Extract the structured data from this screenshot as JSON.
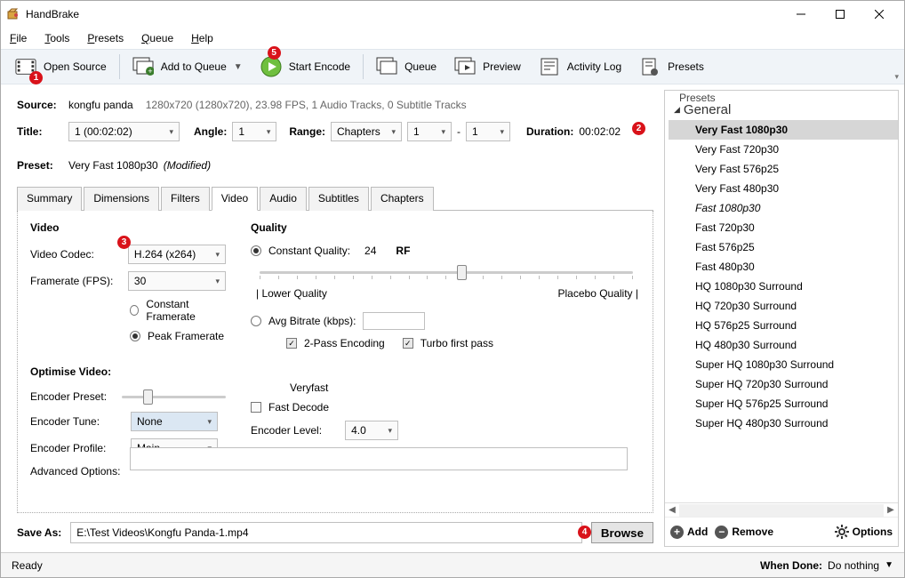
{
  "app": {
    "title": "HandBrake"
  },
  "menus": {
    "file": "File",
    "tools": "Tools",
    "presets": "Presets",
    "queue": "Queue",
    "help": "Help"
  },
  "toolbar": {
    "openSource": "Open Source",
    "addToQueue": "Add to Queue",
    "startEncode": "Start Encode",
    "queue": "Queue",
    "preview": "Preview",
    "activityLog": "Activity Log",
    "presets": "Presets"
  },
  "annotations": {
    "a1": "1",
    "a2": "2",
    "a3": "3",
    "a4": "4",
    "a5": "5"
  },
  "source": {
    "label": "Source:",
    "name": "kongfu panda",
    "meta": "1280x720 (1280x720), 23.98 FPS, 1 Audio Tracks, 0 Subtitle Tracks"
  },
  "title": {
    "label": "Title:",
    "selected": "1 (00:02:02)",
    "angleLabel": "Angle:",
    "angle": "1",
    "rangeLabel": "Range:",
    "rangeType": "Chapters",
    "rangeFrom": "1",
    "rangeDash": "-",
    "rangeTo": "1",
    "durationLabel": "Duration:",
    "duration": "00:02:02"
  },
  "preset": {
    "label": "Preset:",
    "name": "Very Fast 1080p30",
    "modified": "(Modified)"
  },
  "tabs": {
    "summary": "Summary",
    "dimensions": "Dimensions",
    "filters": "Filters",
    "video": "Video",
    "audio": "Audio",
    "subtitles": "Subtitles",
    "chapters": "Chapters"
  },
  "video": {
    "hdrVideo": "Video",
    "hdrQuality": "Quality",
    "codecLabel": "Video Codec:",
    "codec": "H.264 (x264)",
    "fpsLabel": "Framerate (FPS):",
    "fps": "30",
    "cfr": "Constant Framerate",
    "pfr": "Peak Framerate",
    "cq": "Constant Quality:",
    "cqVal": "24",
    "cqUnit": "RF",
    "sliderLow": "| Lower Quality",
    "sliderHigh": "Placebo Quality |",
    "avgBitrate": "Avg Bitrate (kbps):",
    "twoPass": "2-Pass Encoding",
    "turbo": "Turbo first pass",
    "optimiseHdr": "Optimise Video:",
    "encPresetLabel": "Encoder Preset:",
    "encPreset": "Veryfast",
    "encTuneLabel": "Encoder Tune:",
    "encTune": "None",
    "fastDecode": "Fast Decode",
    "encProfileLabel": "Encoder Profile:",
    "encProfile": "Main",
    "encLevelLabel": "Encoder Level:",
    "encLevel": "4.0",
    "advOptLabel": "Advanced Options:"
  },
  "saveAs": {
    "label": "Save As:",
    "path": "E:\\Test Videos\\Kongfu Panda-1.mp4",
    "browse": "Browse"
  },
  "presetsPanel": {
    "title": "Presets",
    "group": "General",
    "items": [
      {
        "label": "Very Fast 1080p30",
        "sel": true
      },
      {
        "label": "Very Fast 720p30"
      },
      {
        "label": "Very Fast 576p25"
      },
      {
        "label": "Very Fast 480p30"
      },
      {
        "label": "Fast 1080p30",
        "ital": true
      },
      {
        "label": "Fast 720p30"
      },
      {
        "label": "Fast 576p25"
      },
      {
        "label": "Fast 480p30"
      },
      {
        "label": "HQ 1080p30 Surround"
      },
      {
        "label": "HQ 720p30 Surround"
      },
      {
        "label": "HQ 576p25 Surround"
      },
      {
        "label": "HQ 480p30 Surround"
      },
      {
        "label": "Super HQ 1080p30 Surround"
      },
      {
        "label": "Super HQ 720p30 Surround"
      },
      {
        "label": "Super HQ 576p25 Surround"
      },
      {
        "label": "Super HQ 480p30 Surround"
      }
    ],
    "add": "Add",
    "remove": "Remove",
    "options": "Options"
  },
  "status": {
    "left": "Ready",
    "whenDoneLabel": "When Done:",
    "whenDone": "Do nothing"
  }
}
